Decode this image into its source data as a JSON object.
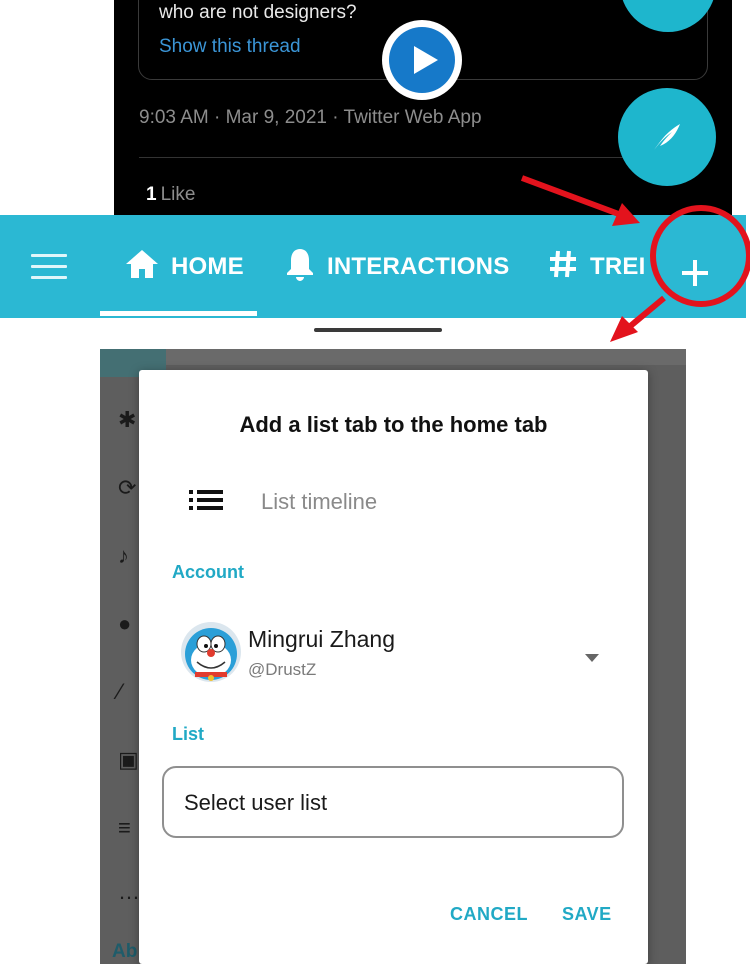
{
  "tweet": {
    "quote_text": "who are not designers?",
    "show_thread_link": "Show this thread",
    "meta": "9:03 AM · Mar 9, 2021 · Twitter Web App",
    "like_count": "1",
    "like_label": "Like",
    "icons": [
      "play-icon",
      "feather-icon",
      "compose-fab-icon"
    ]
  },
  "tabbar": {
    "tabs": [
      {
        "label": "HOME",
        "icon": "home-icon",
        "selected": true
      },
      {
        "label": "INTERACTIONS",
        "icon": "bell-icon",
        "selected": false
      },
      {
        "label": "TREI",
        "icon": "hashtag-icon",
        "selected": false
      }
    ],
    "menu_icon": "hamburger-icon",
    "add_icon": "plus-icon"
  },
  "drawer": {
    "partial_label": "Ab"
  },
  "dialog": {
    "title": "Add a list tab to the home tab",
    "tab_type_label": "List timeline",
    "account_section_label": "Account",
    "account": {
      "name": "Mingrui Zhang",
      "handle": "@DrustZ"
    },
    "list_section_label": "List",
    "list_select_placeholder": "Select user list",
    "cancel_label": "CANCEL",
    "save_label": "SAVE"
  },
  "colors": {
    "accent": "#2bb8d3",
    "annotation_red": "#e3131d",
    "link_blue": "#3b95d6"
  }
}
